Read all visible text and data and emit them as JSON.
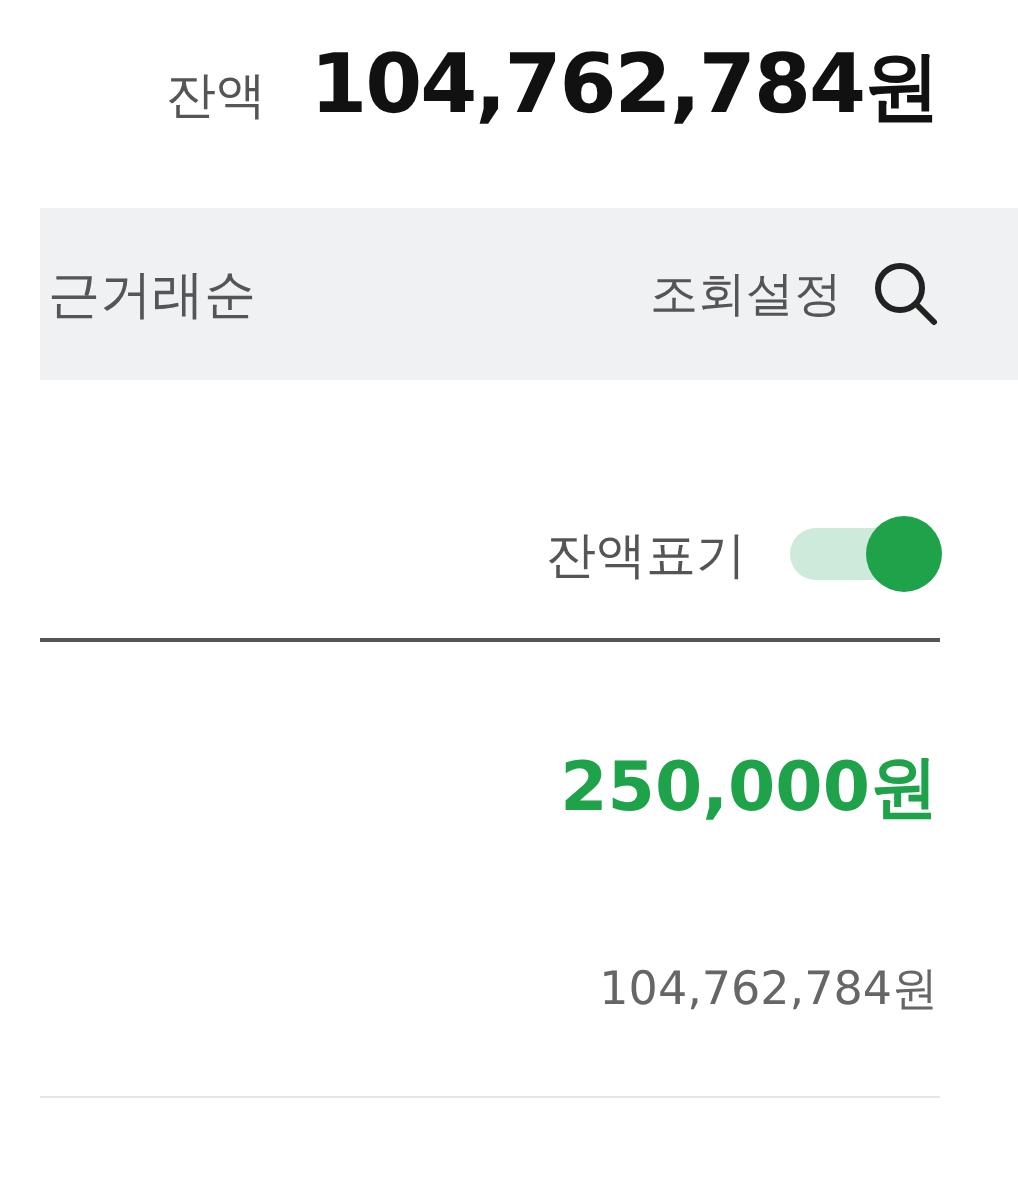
{
  "balance": {
    "label": "잔액",
    "amount": "104,762,784",
    "unit": "원"
  },
  "filter_bar": {
    "sort": "근거래순",
    "settings": "조회설정"
  },
  "balance_toggle": {
    "label": "잔액표기",
    "on": true
  },
  "transaction": {
    "amount": "250,000원",
    "balance_after": "104,762,784원"
  }
}
